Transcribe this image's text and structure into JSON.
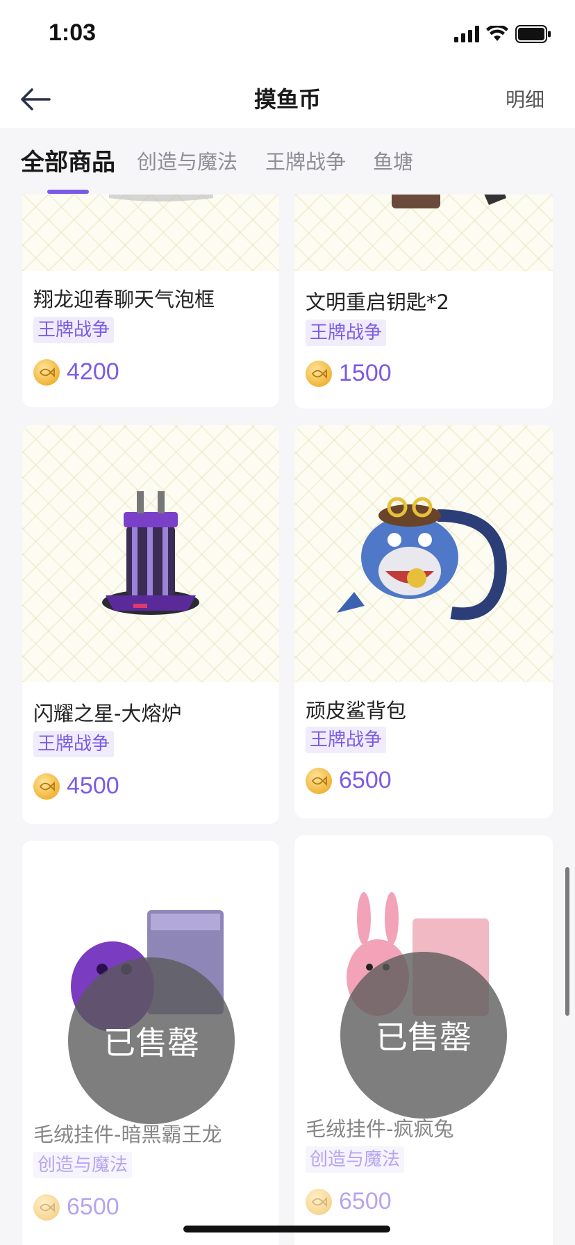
{
  "status": {
    "time": "1:03"
  },
  "nav": {
    "title": "摸鱼币",
    "detail_label": "明细"
  },
  "tabs": [
    {
      "label": "全部商品",
      "active": true
    },
    {
      "label": "创造与魔法",
      "active": false
    },
    {
      "label": "王牌战争",
      "active": false
    },
    {
      "label": "鱼塘",
      "active": false
    }
  ],
  "products": [
    {
      "name": "翔龙迎春聊天气泡框",
      "tag": "王牌战争",
      "price": "4200",
      "sold_out": false
    },
    {
      "name": "文明重启钥匙*2",
      "tag": "王牌战争",
      "price": "1500",
      "sold_out": false
    },
    {
      "name": "闪耀之星-大熔炉",
      "tag": "王牌战争",
      "price": "4500",
      "sold_out": false
    },
    {
      "name": "顽皮鲨背包",
      "tag": "王牌战争",
      "price": "6500",
      "sold_out": false
    },
    {
      "name": "毛绒挂件-暗黑霸王龙",
      "tag": "创造与魔法",
      "price": "6500",
      "sold_out": true,
      "sold_label": "已售罄"
    },
    {
      "name": "毛绒挂件-疯疯兔",
      "tag": "创造与魔法",
      "price": "6500",
      "sold_out": true,
      "sold_label": "已售罄"
    }
  ],
  "colors": {
    "accent": "#7b5be6",
    "tag_bg": "#f0ecfc",
    "coin": "#f1b53a",
    "page_bg": "#f6f6f8"
  },
  "icons": {
    "back": "arrow-left-icon",
    "coin": "fish-coin-icon",
    "signal": "signal-icon",
    "wifi": "wifi-icon",
    "battery": "battery-icon"
  }
}
